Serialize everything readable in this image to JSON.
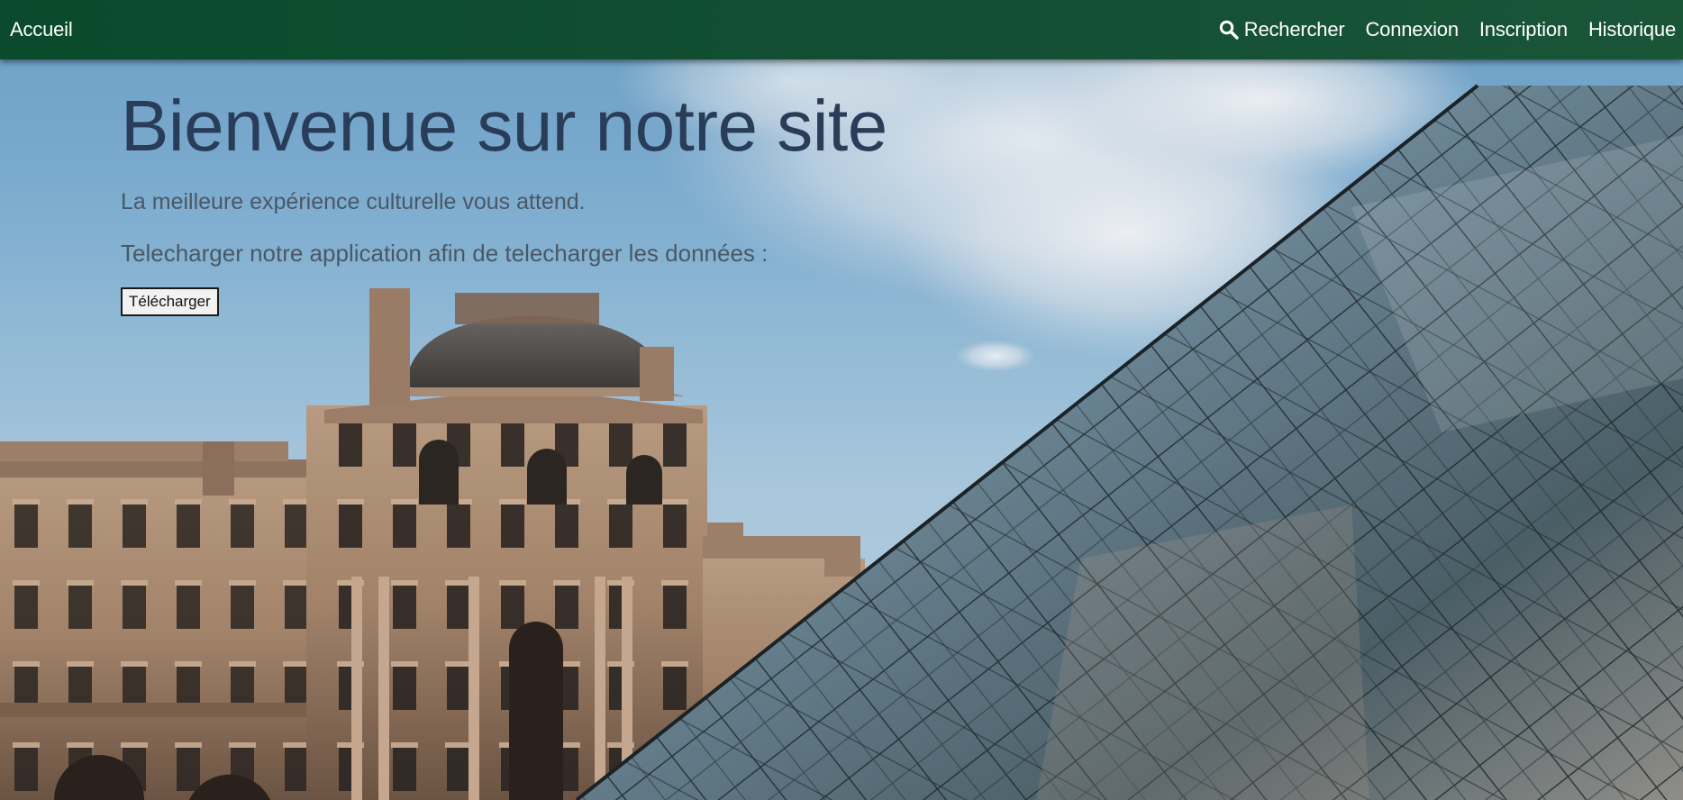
{
  "navbar": {
    "home": "Accueil",
    "search": "Rechercher",
    "login": "Connexion",
    "signup": "Inscription",
    "history": "Historique"
  },
  "hero": {
    "title": "Bienvenue sur notre site",
    "subtitle": "La meilleure expérience culturelle vous attend.",
    "download_text": "Telecharger notre application afin de telecharger les données :",
    "download_button": "Télécharger",
    "background_image": "louvre-pyramid-photo"
  },
  "colors": {
    "navbar": "#0b4a2c",
    "title": "#2a3d58",
    "text": "#4a5866"
  }
}
